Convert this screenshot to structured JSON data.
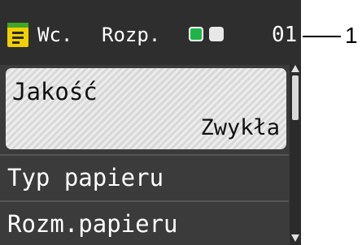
{
  "status": {
    "icon": "copy-document-icon",
    "mode_a": "Wc.",
    "mode_b": "Rozp.",
    "indicators": [
      "green-square-icon",
      "white-square-icon"
    ],
    "count": "01"
  },
  "callout": {
    "number": "1"
  },
  "menu": {
    "items": [
      {
        "label": "Jakość",
        "value": "Zwykła",
        "selected": true
      },
      {
        "label": "Typ papieru"
      },
      {
        "label": "Rozm.papieru"
      }
    ]
  },
  "colors": {
    "lcd_bg": "#3b3b3b",
    "selected_bg": "#e4e4e4",
    "accent_green": "#1fb44a",
    "icon_yellow": "#f0d000"
  }
}
